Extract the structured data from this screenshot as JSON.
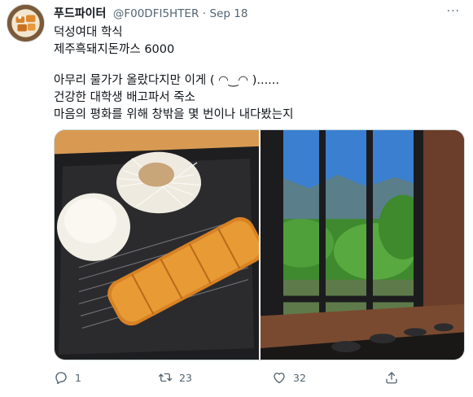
{
  "tweet": {
    "display_name": "푸드파이터",
    "handle": "@F00DFI5HTER",
    "separator": "·",
    "date": "Sep 18",
    "more_label": "···",
    "lines": [
      "덕성여대 학식",
      "제주흑돼지돈까스 6000",
      "",
      "아무리 물가가 올랐다지만 이게 ( ◠‿◠ )......",
      "건강한 대학생 배고파서 죽소",
      "마음의 평화를 위해 창밖을 몇 번이나 내다봤는지"
    ]
  },
  "media": {
    "photos": [
      {
        "icon": "tonkatsu-meal-photo"
      },
      {
        "icon": "cafeteria-window-view-photo"
      }
    ]
  },
  "actions": {
    "reply_count": "1",
    "retweet_count": "23",
    "like_count": "32",
    "colors": {
      "icon": "#536471"
    }
  }
}
